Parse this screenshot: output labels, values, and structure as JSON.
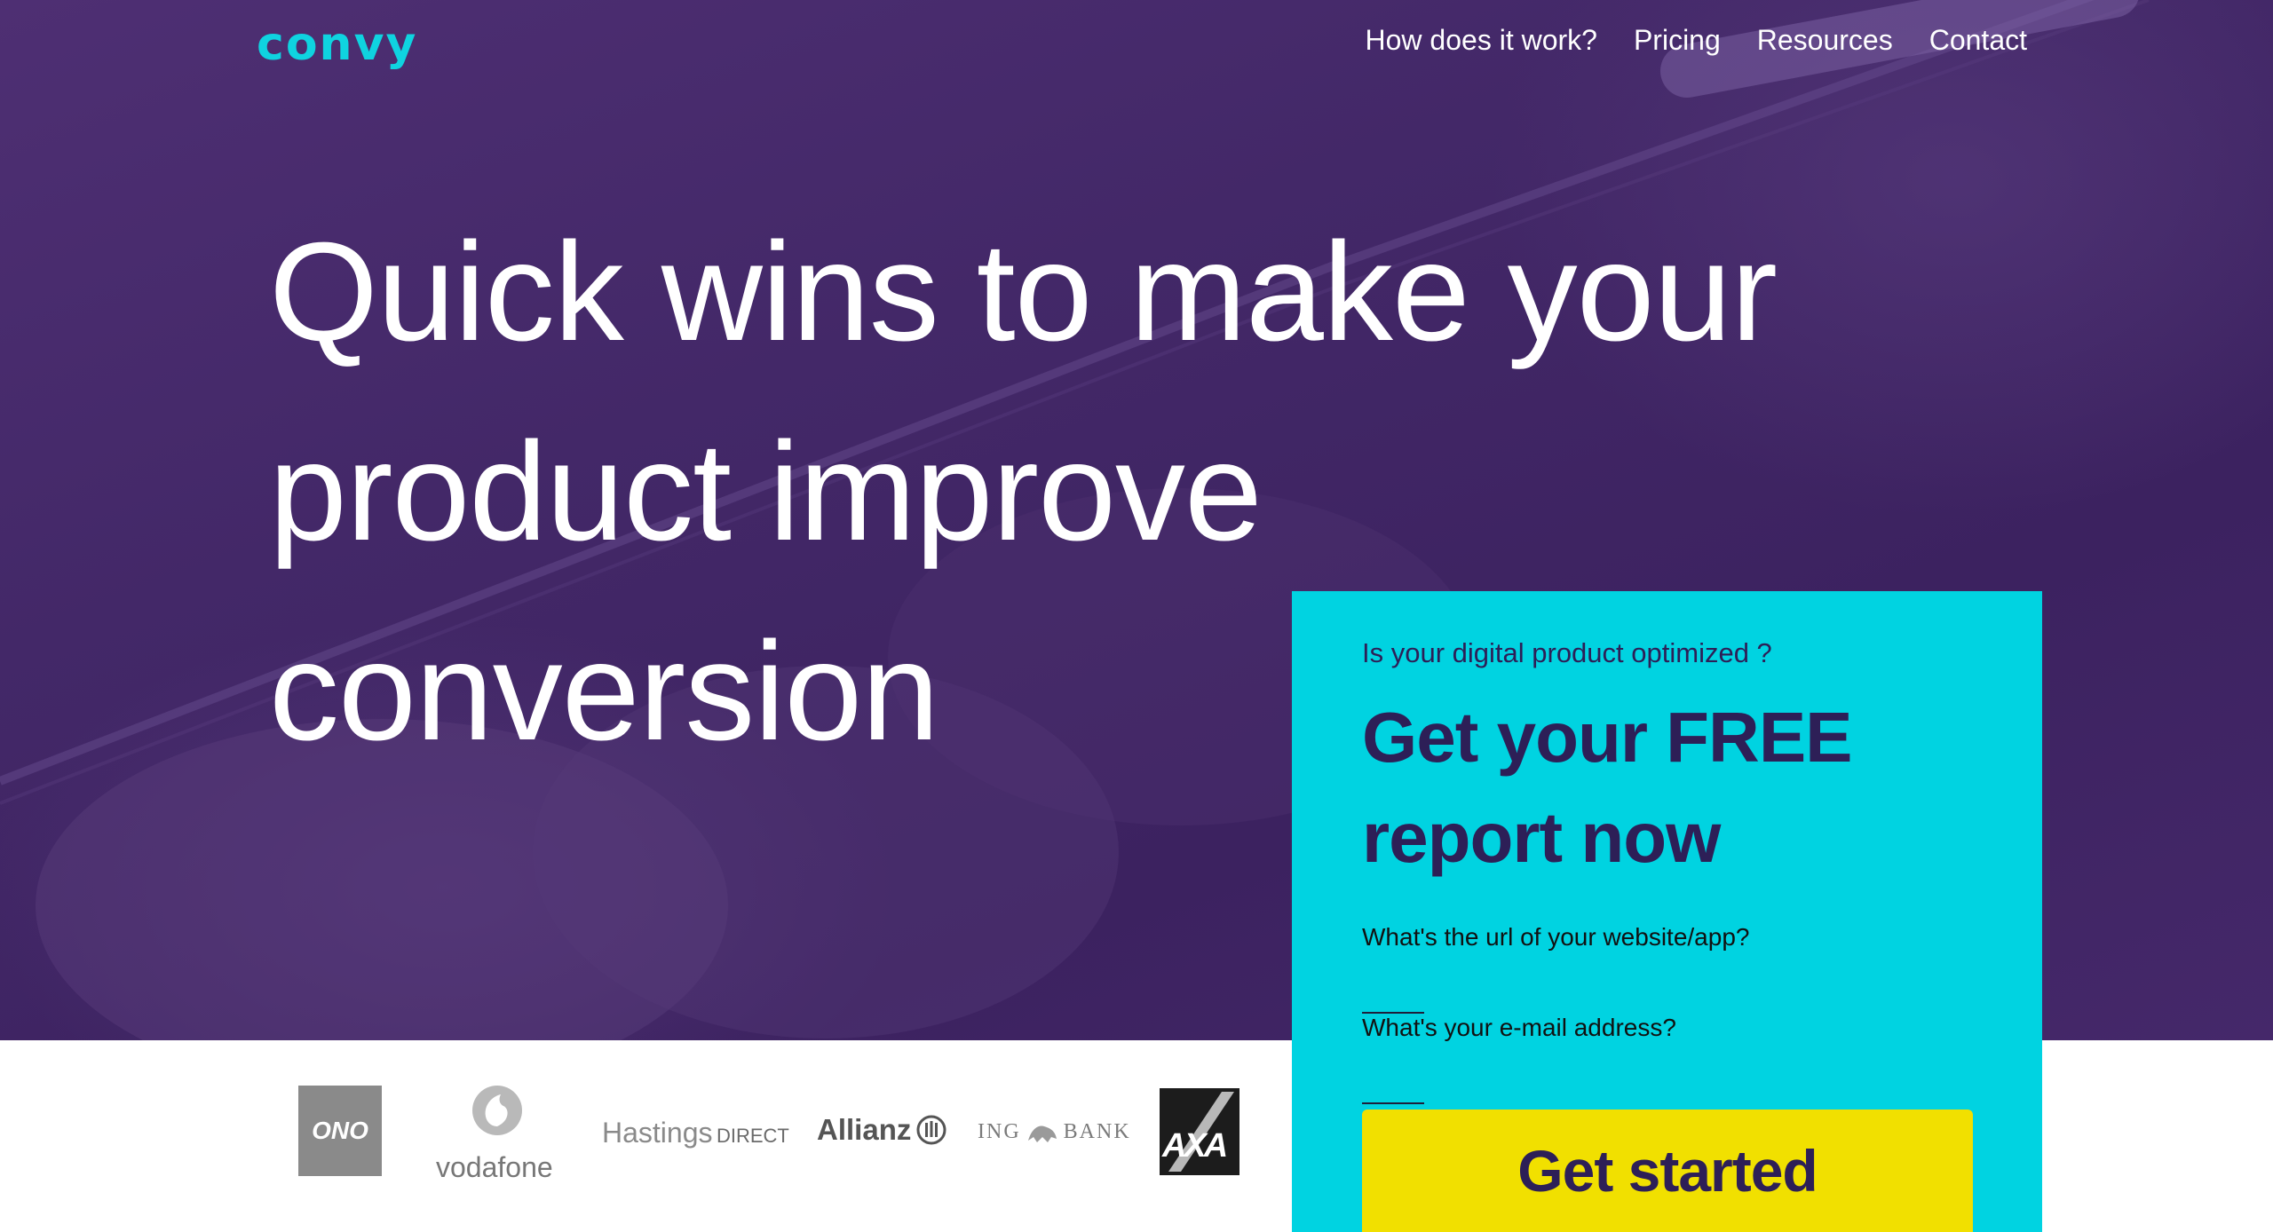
{
  "brand": {
    "logo": "convy",
    "accent_color": "#0fd3e0",
    "hero_color": "#432868",
    "card_color": "#00d3e1",
    "cta_color": "#f1e000"
  },
  "nav": {
    "items": [
      "How does it work?",
      "Pricing",
      "Resources",
      "Contact"
    ]
  },
  "hero": {
    "headline": "Quick wins to make your product improve conversion"
  },
  "form": {
    "eyebrow": "Is your digital product optimized ?",
    "title": "Get your FREE report now",
    "url_label": "What's the url of your website/app?",
    "url_value": "",
    "email_label": "What's your e-mail address?",
    "email_value": "",
    "cta": "Get started"
  },
  "partners": {
    "logos": [
      {
        "name": "ono",
        "text": "ONO"
      },
      {
        "name": "vodafone",
        "text": "vodafone"
      },
      {
        "name": "hastings-direct",
        "text_main": "Hastings",
        "text_sub": "DIRECT"
      },
      {
        "name": "allianz",
        "text": "Allianz"
      },
      {
        "name": "ing-bank",
        "text_left": "ING",
        "text_right": "BANK"
      },
      {
        "name": "axa",
        "text": "AXA"
      }
    ]
  }
}
